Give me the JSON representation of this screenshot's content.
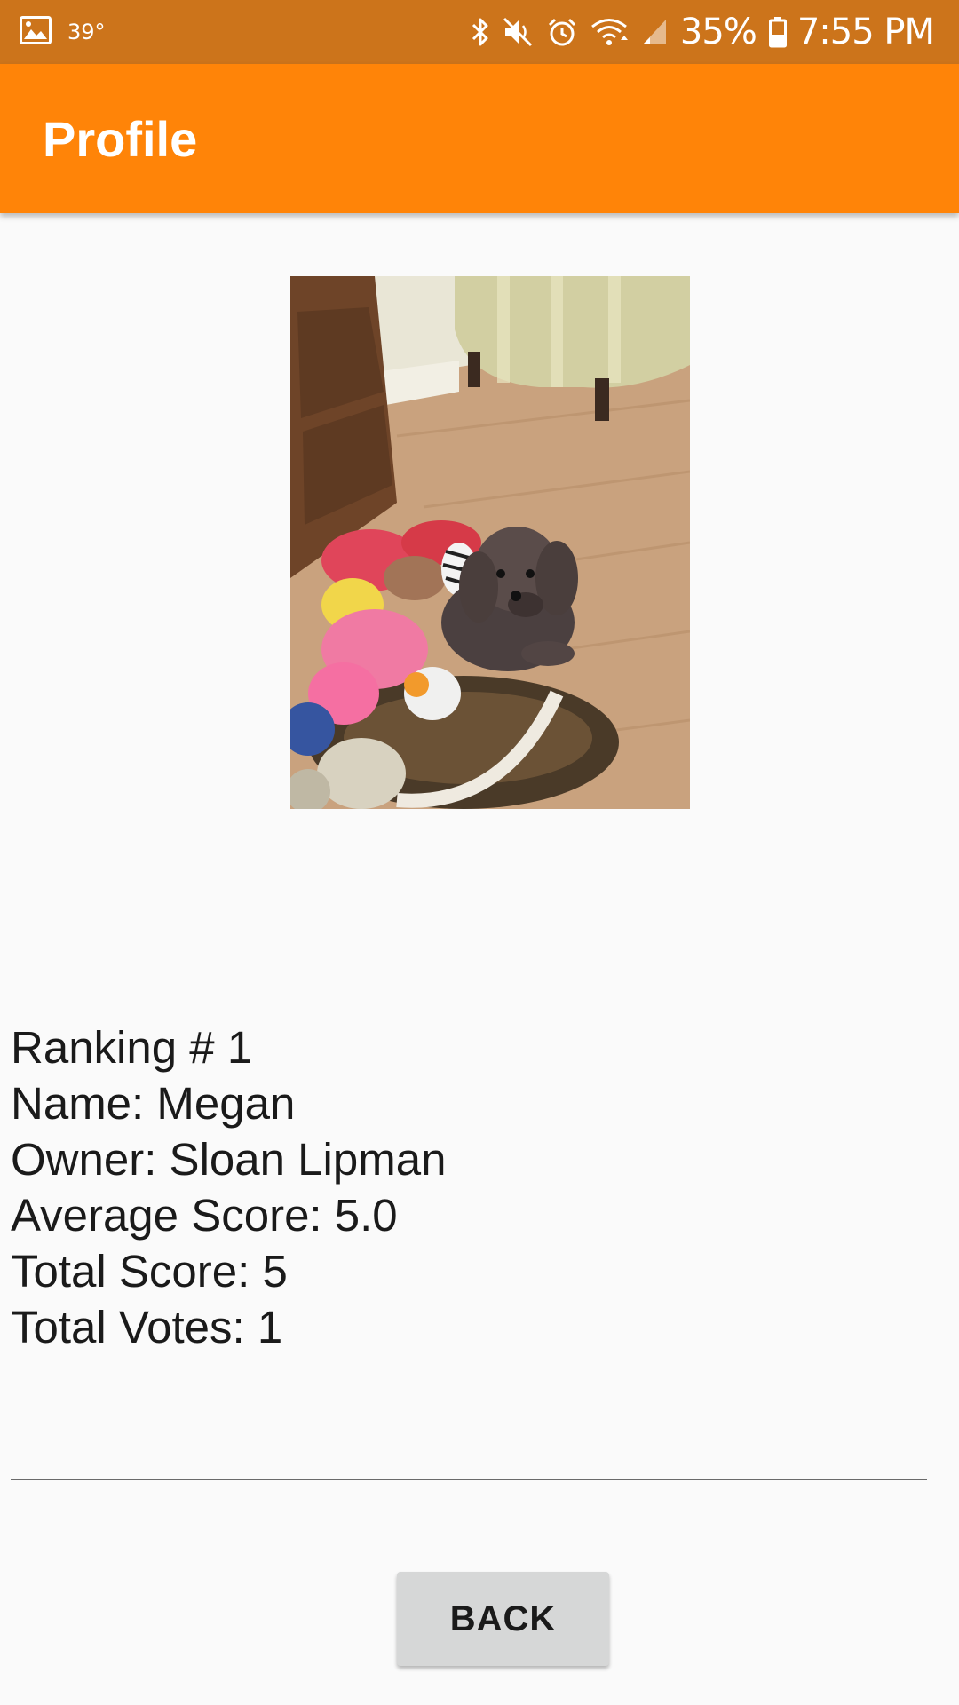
{
  "status_bar": {
    "temperature": "39°",
    "battery_percent": "35%",
    "time": "7:55 PM",
    "icons": [
      "gallery-icon",
      "bluetooth-icon",
      "mute-icon",
      "alarm-icon",
      "wifi-icon",
      "signal-icon",
      "battery-icon"
    ],
    "background": "#cc741b"
  },
  "app_bar": {
    "title": "Profile",
    "background": "#ff8408"
  },
  "profile": {
    "photo": "dog-photo",
    "ranking": "Ranking # 1",
    "name": "Name: Megan",
    "owner": "Owner: Sloan Lipman",
    "average_score": "Average Score: 5.0",
    "total_score": "Total Score: 5",
    "total_votes": "Total Votes: 1"
  },
  "actions": {
    "back_label": "BACK"
  }
}
